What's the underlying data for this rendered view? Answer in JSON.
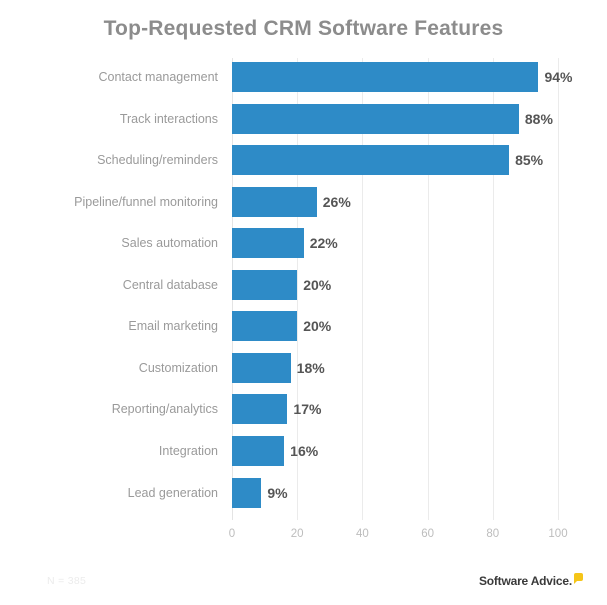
{
  "chart_data": {
    "type": "bar",
    "orientation": "horizontal",
    "title": "Top-Requested CRM Software Features",
    "xlabel": "",
    "ylabel": "",
    "xlim": [
      0,
      100
    ],
    "xticks": [
      "0",
      "20",
      "40",
      "60",
      "80",
      "100"
    ],
    "grid": true,
    "legend": null,
    "bar_color": "#2e8bc7",
    "value_suffix": "%",
    "categories": [
      "Contact management",
      "Track interactions",
      "Scheduling/reminders",
      "Pipeline/funnel monitoring",
      "Sales automation",
      "Central database",
      "Email marketing",
      "Customization",
      "Reporting/analytics",
      "Integration",
      "Lead generation"
    ],
    "values": [
      94,
      88,
      85,
      26,
      22,
      20,
      20,
      18,
      17,
      16,
      9
    ],
    "value_labels": [
      "94%",
      "88%",
      "85%",
      "26%",
      "22%",
      "20%",
      "20%",
      "18%",
      "17%",
      "16%",
      "9%"
    ]
  },
  "footnote": "N = 385",
  "brand": {
    "name": "Software Advice.",
    "mark": "speech-bubble-icon",
    "mark_color": "#f5c518"
  }
}
